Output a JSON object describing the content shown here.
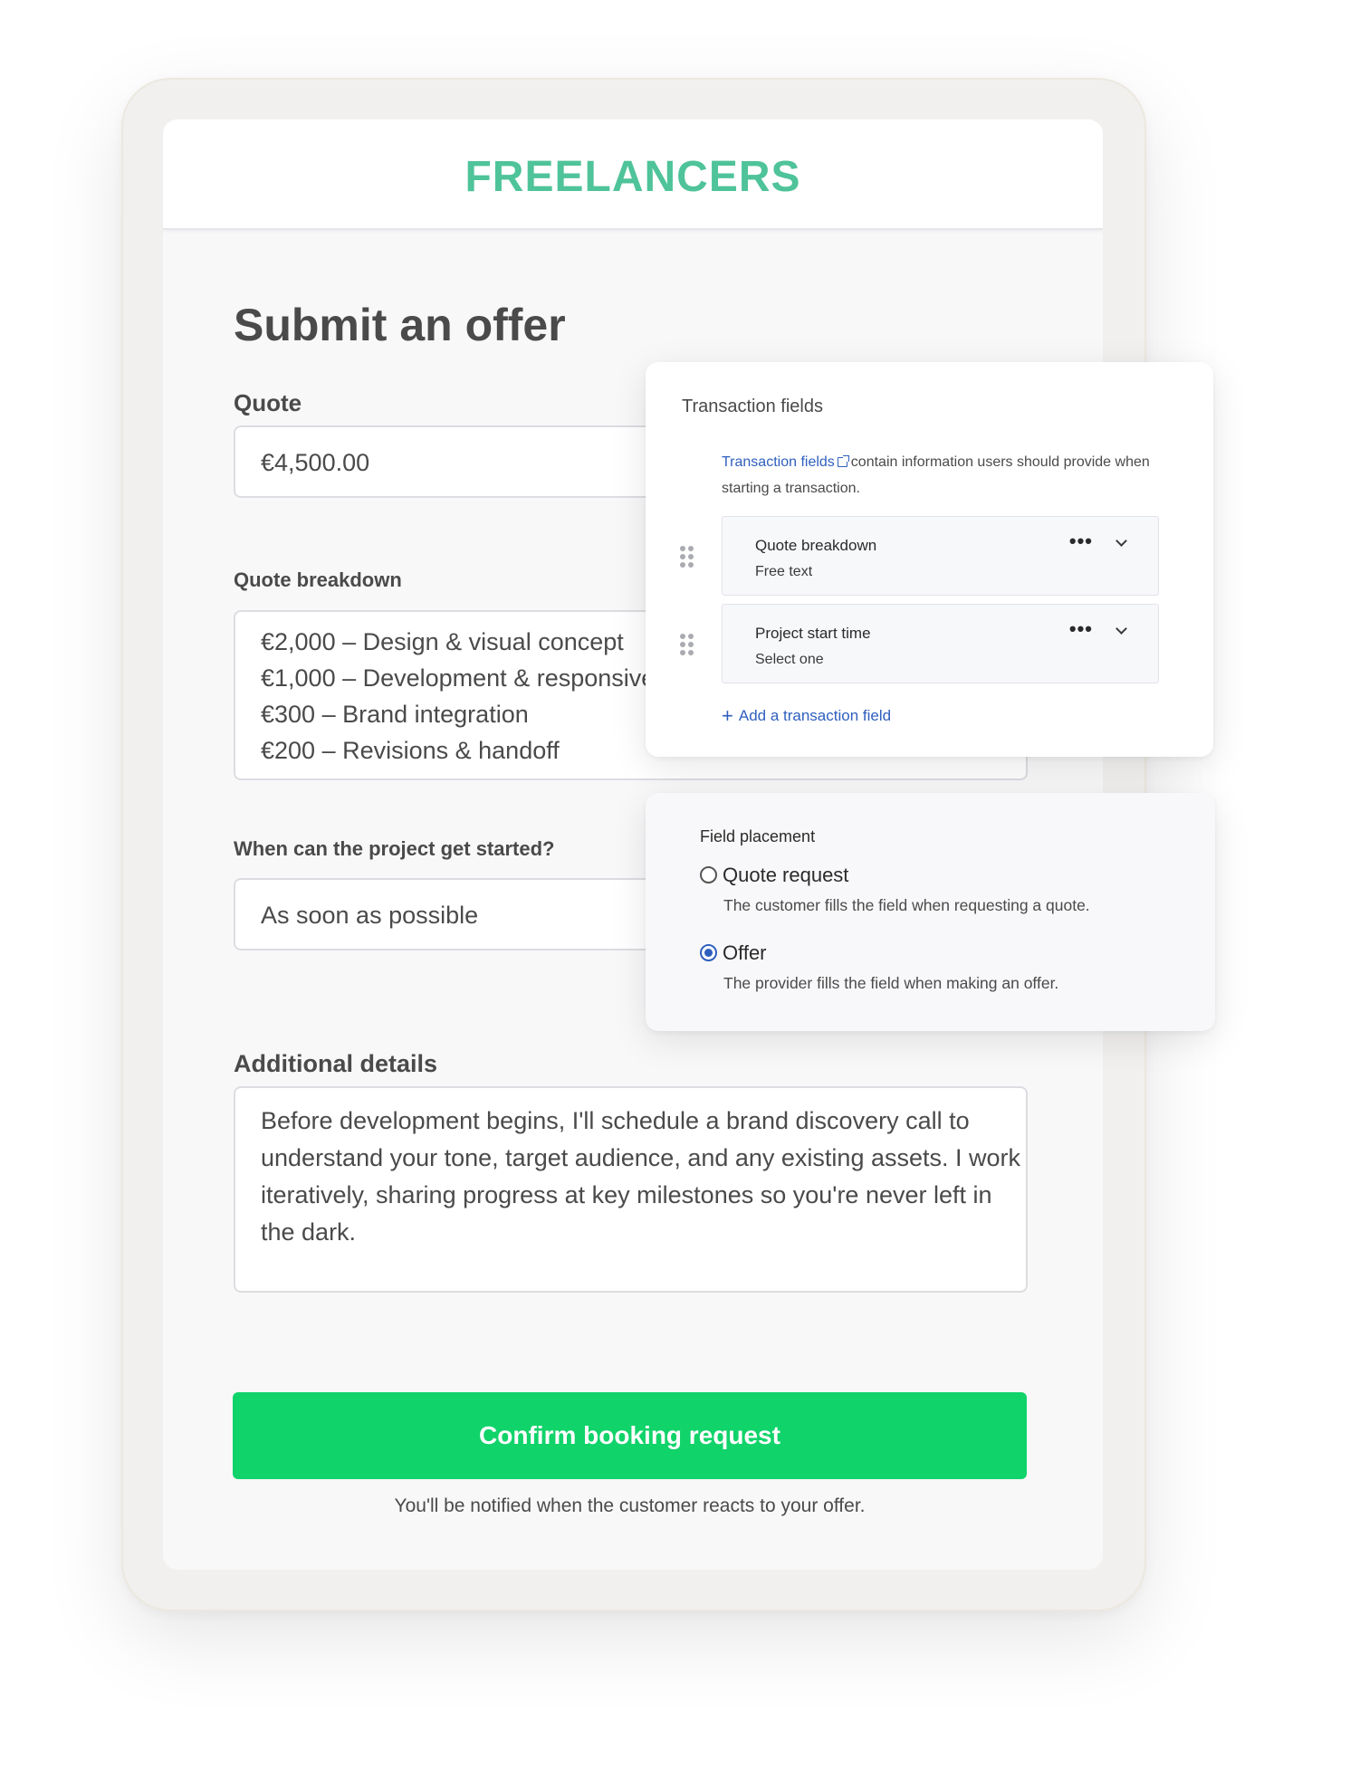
{
  "brand": {
    "name": "FREELANCERS",
    "color": "#4fc39a"
  },
  "page": {
    "title": "Submit an offer"
  },
  "quote": {
    "label": "Quote",
    "value": "€4,500.00"
  },
  "breakdown": {
    "label": "Quote breakdown",
    "lines": [
      "€2,000 – Design & visual concept",
      "€1,000 – Development & responsive layout",
      "€300 – Brand integration",
      "€200 – Revisions & handoff"
    ]
  },
  "start": {
    "label": "When can the project get started?",
    "value": "As soon as possible"
  },
  "details": {
    "label": "Additional details",
    "value": "Before development begins, I'll schedule a brand discovery call to understand your tone, target audience, and any existing assets. I work iteratively, sharing progress at key milestones so you're never left in the dark."
  },
  "cta": {
    "label": "Confirm booking request",
    "note": "You'll be notified when the customer reacts to your offer.",
    "color": "#10d36a"
  },
  "transaction_panel": {
    "title": "Transaction fields",
    "intro_link": "Transaction fields",
    "intro_text": "contain information users should provide when starting a transaction.",
    "fields": [
      {
        "name": "Quote breakdown",
        "type": "Free text"
      },
      {
        "name": "Project start time",
        "type": "Select one"
      }
    ],
    "more_label": "•••",
    "add_label": "Add a transaction field",
    "add_icon": "+"
  },
  "placement_panel": {
    "title": "Field placement",
    "options": [
      {
        "label": "Quote request",
        "desc": "The customer fills the field when requesting a quote.",
        "selected": false
      },
      {
        "label": "Offer",
        "desc": "The provider fills the field when making an offer.",
        "selected": true
      }
    ],
    "accent": "#2f5fbe"
  }
}
